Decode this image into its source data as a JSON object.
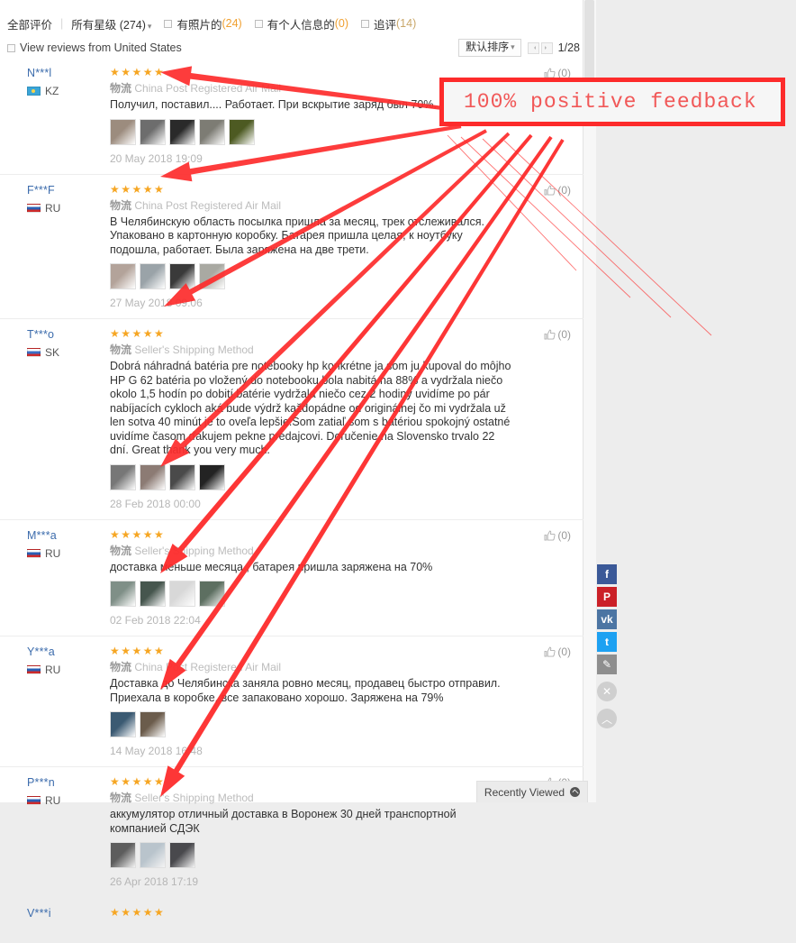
{
  "filter_bar": {
    "all_reviews": "全部评价",
    "all_stars": "所有星级 (274)",
    "with_photos_label": "有照片的",
    "with_photos_count": "(24)",
    "with_personal_label": "有个人信息的",
    "with_personal_count": "(0)",
    "additional_label": "追评",
    "additional_count": "(14)"
  },
  "toolbar": {
    "view_reviews_label": "View reviews from United States",
    "sort_label": "默认排序",
    "page_indicator": "1/28"
  },
  "annotation": {
    "text": "100% positive feedback",
    "border_color": "#fd2b2b",
    "text_color": "#f15858"
  },
  "recently_viewed": {
    "label": "Recently Viewed"
  },
  "social_rail": [
    {
      "name": "facebook-share-button",
      "glyph": "f",
      "color": "#3b5998"
    },
    {
      "name": "pinterest-share-button",
      "glyph": "P",
      "color": "#cb2027"
    },
    {
      "name": "vk-share-button",
      "glyph": "vk",
      "color": "#4c75a3"
    },
    {
      "name": "twitter-share-button",
      "glyph": "t",
      "color": "#1da1f2"
    },
    {
      "name": "edit-button",
      "glyph": "✎",
      "color": "#8e8e8e"
    }
  ],
  "rail_controls": [
    {
      "name": "close-rail-button",
      "glyph": "✕"
    },
    {
      "name": "scroll-to-top-button",
      "glyph": "︿"
    }
  ],
  "reviews": [
    {
      "user": "N***l",
      "country": "KZ",
      "flag": "kz",
      "stars": 5,
      "shipping_tag": "物流",
      "shipping": "China Post Registered Air Mail",
      "text": "Получил, поставил.... Работает. При вскрытие заряд был 70%.",
      "date": "20 May 2018 19:09",
      "helpful": "(0)",
      "thumb_colors": [
        "#9c8c7e",
        "#6d6d6d",
        "#2a2a2a",
        "#7d7c74",
        "#4d5a22"
      ]
    },
    {
      "user": "F***F",
      "country": "RU",
      "flag": "ru",
      "stars": 5,
      "shipping_tag": "物流",
      "shipping": "China Post Registered Air Mail",
      "text": "В Челябинскую область посылка пришла за месяц, трек отслеживался. Упаковано в картонную коробку. Батарея пришла целая, к ноутбуку подошла, работает. Была заряжена на две трети.",
      "date": "27 May 2018 09:06",
      "helpful": "(0)",
      "thumb_colors": [
        "#b3a39a",
        "#9aa3a8",
        "#3a3a3a",
        "#a9a9a2"
      ]
    },
    {
      "user": "T***o",
      "country": "SK",
      "flag": "sk",
      "stars": 5,
      "shipping_tag": "物流",
      "shipping": "Seller's Shipping Method",
      "text": "Dobrá náhradná batéria pre notebooky hp konkrétne ja som ju kupoval do môjho HP G 62 batéria po vložený do notebooku bola nabitá na 88% a vydržala niečo okolo 1,5 hodín po dobití batérie vydržala niečo cez 2 hodiny uvidíme po pár nabíjacích cykloch aká bude výdrž každopádne od originálnej čo mi vydržala už len sotva 40 minút je to oveľa lepšie.Som zatiaľ som s batériou spokojný ostatné uvidíme časom ďakujem pekne predajcovi. Doručenie na Slovensko trvalo 22 dní. Great thank you very much.",
      "date": "28 Feb 2018 00:00",
      "helpful": "(0)",
      "thumb_colors": [
        "#777777",
        "#8c7b74",
        "#4a4a4a",
        "#232323"
      ]
    },
    {
      "user": "M***a",
      "country": "RU",
      "flag": "ru",
      "stars": 5,
      "shipping_tag": "物流",
      "shipping": "Seller's Shipping Method",
      "text": "доставка меньше месяца , батарея пришла заряжена на 70%",
      "date": "02 Feb 2018 22:04",
      "helpful": "(0)",
      "thumb_colors": [
        "#7f8f87",
        "#46564e",
        "#d8d8d8",
        "#5d6f61"
      ]
    },
    {
      "user": "Y***a",
      "country": "RU",
      "flag": "ru",
      "stars": 5,
      "shipping_tag": "物流",
      "shipping": "China Post Registered Air Mail",
      "text": "Доставка до Челябинска заняла ровно месяц, продавец быстро отправил. Приехала в коробке, все запаковано хорошо. Заряжена на 79%",
      "date": "14 May 2018 16:48",
      "helpful": "(0)",
      "thumb_colors": [
        "#3b5a72",
        "#6b5c4c"
      ]
    },
    {
      "user": "P***n",
      "country": "RU",
      "flag": "ru",
      "stars": 5,
      "shipping_tag": "物流",
      "shipping": "Seller's Shipping Method",
      "text": "аккумулятор отличный доставка в Воронеж 30 дней транспортной компанией СДЭК",
      "date": "26 Apr 2018 17:19",
      "helpful": "(0)",
      "thumb_colors": [
        "#5d5d5d",
        "#b9c4cc",
        "#49494d"
      ]
    },
    {
      "user": "V***i",
      "country": "",
      "flag": "",
      "stars": 5,
      "shipping_tag": "",
      "shipping": "",
      "text": "",
      "date": "",
      "helpful": "",
      "thumb_colors": []
    }
  ]
}
